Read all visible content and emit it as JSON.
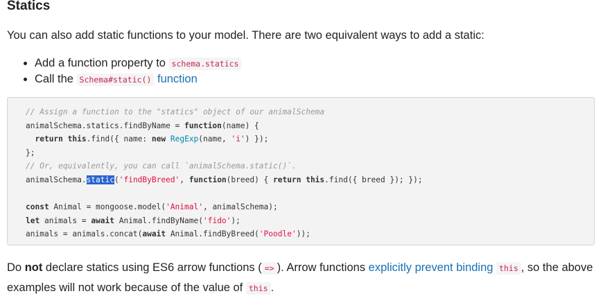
{
  "heading": "Statics",
  "intro": "You can also add static functions to your model. There are two equivalent ways to add a static:",
  "bullets": {
    "item1": {
      "text": "Add a function property to ",
      "code": "schema.statics"
    },
    "item2": {
      "prefix": "Call the ",
      "code": "Schema#static()",
      "link": "function"
    }
  },
  "code_lines": [
    "// Assign a function to the \"statics\" object of our animalSchema",
    "animalSchema.statics.findByName = function(name) {",
    "  return this.find({ name: new RegExp(name, 'i') });",
    "};",
    "// Or, equivalently, you can call `animalSchema.static()`.",
    "animalSchema.static('findByBreed', function(breed) { return this.find({ breed }); });",
    "",
    "const Animal = mongoose.model('Animal', animalSchema);",
    "let animals = await Animal.findByName('fido');",
    "animals = animals.concat(await Animal.findByBreed('Poodle'));"
  ],
  "outro": {
    "p1": "Do ",
    "strong": "not",
    "p2": " declare statics using ES6 arrow functions (",
    "code_arrow": "=>",
    "p3": "). Arrow functions ",
    "link": "explicitly prevent binding",
    "p4": " ",
    "code_this1": "this",
    "p5": ", so the above examples will not work because of the value of ",
    "code_this2": "this",
    "p6": "."
  }
}
